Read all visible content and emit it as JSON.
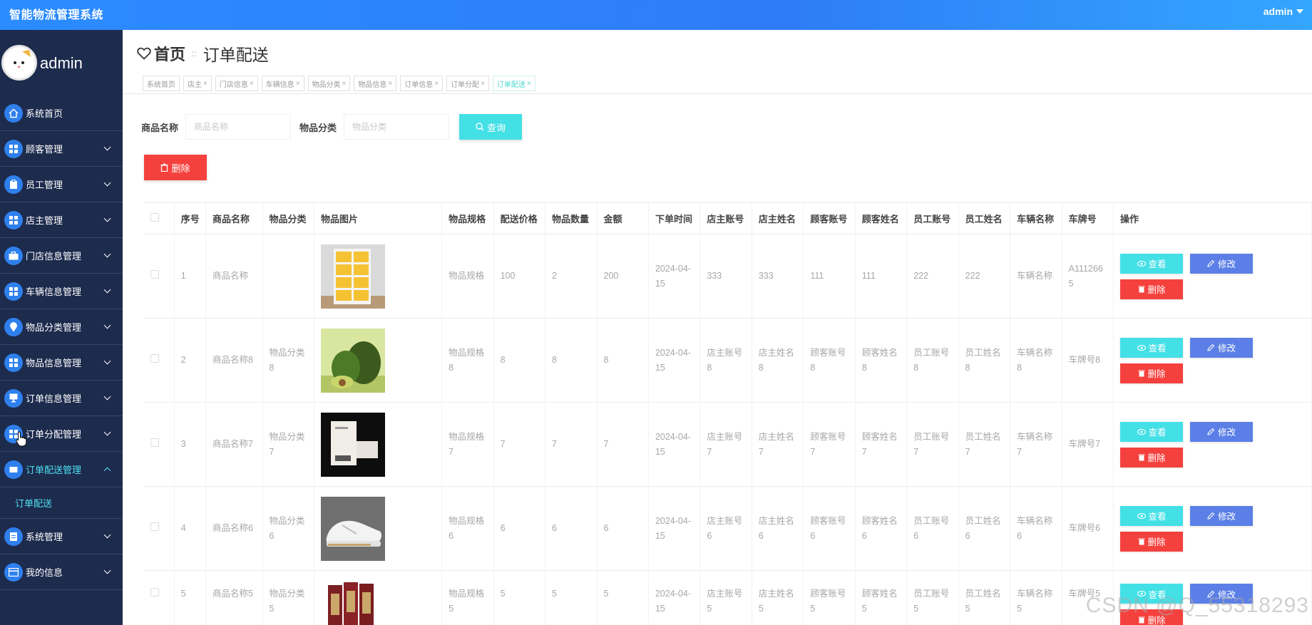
{
  "app": {
    "title": "智能物流管理系统",
    "user": "admin"
  },
  "sidebar": {
    "profile_name": "admin",
    "items": [
      {
        "label": "系统首页"
      },
      {
        "label": "顾客管理"
      },
      {
        "label": "员工管理"
      },
      {
        "label": "店主管理"
      },
      {
        "label": "门店信息管理"
      },
      {
        "label": "车辆信息管理"
      },
      {
        "label": "物品分类管理"
      },
      {
        "label": "物品信息管理"
      },
      {
        "label": "订单信息管理"
      },
      {
        "label": "订单分配管理"
      },
      {
        "label": "订单配送管理"
      },
      {
        "label": "系统管理"
      },
      {
        "label": "我的信息"
      }
    ],
    "submenu": {
      "label": "订单配送"
    }
  },
  "header": {
    "home": "首页",
    "separator": "::",
    "current": "订单配送"
  },
  "tags": [
    "系统首页",
    "店主",
    "门店信息",
    "车辆信息",
    "物品分类",
    "物品信息",
    "订单信息",
    "订单分配",
    "订单配送"
  ],
  "tag_close": "×",
  "search": {
    "field1_label": "商品名称",
    "field1_placeholder": "商品名称",
    "field2_label": "物品分类",
    "field2_placeholder": "物品分类",
    "query_label": "查询"
  },
  "delete_label": "删除",
  "table": {
    "headers": [
      "序号",
      "商品名称",
      "物品分类",
      "物品图片",
      "物品规格",
      "配送价格",
      "物品数量",
      "金额",
      "下单时间",
      "店主账号",
      "店主姓名",
      "顾客账号",
      "顾客姓名",
      "员工账号",
      "员工姓名",
      "车辆名称",
      "车牌号",
      "操作"
    ],
    "rows": [
      {
        "no": "1",
        "name": "商品名称",
        "cat": "",
        "img": "locker",
        "spec": "物品规格",
        "price": "100",
        "qty": "2",
        "amount": "200",
        "time": "2024-04-15",
        "owner_acc": "333",
        "owner_name": "333",
        "cust_acc": "111",
        "cust_name": "111",
        "emp_acc": "222",
        "emp_name": "222",
        "vehicle": "车辆名称",
        "plate": "A1112665"
      },
      {
        "no": "2",
        "name": "商品名称8",
        "cat": "物品分类8",
        "img": "avocado",
        "spec": "物品规格8",
        "price": "8",
        "qty": "8",
        "amount": "8",
        "time": "2024-04-15",
        "owner_acc": "店主账号8",
        "owner_name": "店主姓名8",
        "cust_acc": "顾客账号8",
        "cust_name": "顾客姓名8",
        "emp_acc": "员工账号8",
        "emp_name": "员工姓名8",
        "vehicle": "车辆名称8",
        "plate": "车牌号8"
      },
      {
        "no": "3",
        "name": "商品名称7",
        "cat": "物品分类7",
        "img": "book",
        "spec": "物品规格7",
        "price": "7",
        "qty": "7",
        "amount": "7",
        "time": "2024-04-15",
        "owner_acc": "店主账号7",
        "owner_name": "店主姓名7",
        "cust_acc": "顾客账号7",
        "cust_name": "顾客姓名7",
        "emp_acc": "员工账号7",
        "emp_name": "员工姓名7",
        "vehicle": "车辆名称7",
        "plate": "车牌号7"
      },
      {
        "no": "4",
        "name": "商品名称6",
        "cat": "物品分类6",
        "img": "shoe",
        "spec": "物品规格6",
        "price": "6",
        "qty": "6",
        "amount": "6",
        "time": "2024-04-15",
        "owner_acc": "店主账号6",
        "owner_name": "店主姓名6",
        "cust_acc": "顾客账号6",
        "cust_name": "顾客姓名6",
        "emp_acc": "员工账号6",
        "emp_name": "员工姓名6",
        "vehicle": "车辆名称6",
        "plate": "车牌号6"
      },
      {
        "no": "5",
        "name": "商品名称5",
        "cat": "物品分类5",
        "img": "books-red",
        "spec": "物品规格5",
        "price": "5",
        "qty": "5",
        "amount": "5",
        "time": "2024-04-15",
        "owner_acc": "店主账号5",
        "owner_name": "店主姓名5",
        "cust_acc": "顾客账号5",
        "cust_name": "顾客姓名5",
        "emp_acc": "员工账号5",
        "emp_name": "员工姓名5",
        "vehicle": "车辆名称5",
        "plate": "车牌号5"
      }
    ],
    "actions": {
      "view": "查看",
      "edit": "修改",
      "delete": "删除"
    }
  },
  "watermark": "CSDN @Q_55318293",
  "colors": {
    "topbar": "#2e7cf6",
    "sidebar": "#1d2b4d",
    "accent_cyan": "#43e0e6",
    "edit_blue": "#5b7fe6",
    "danger": "#f5413d"
  }
}
